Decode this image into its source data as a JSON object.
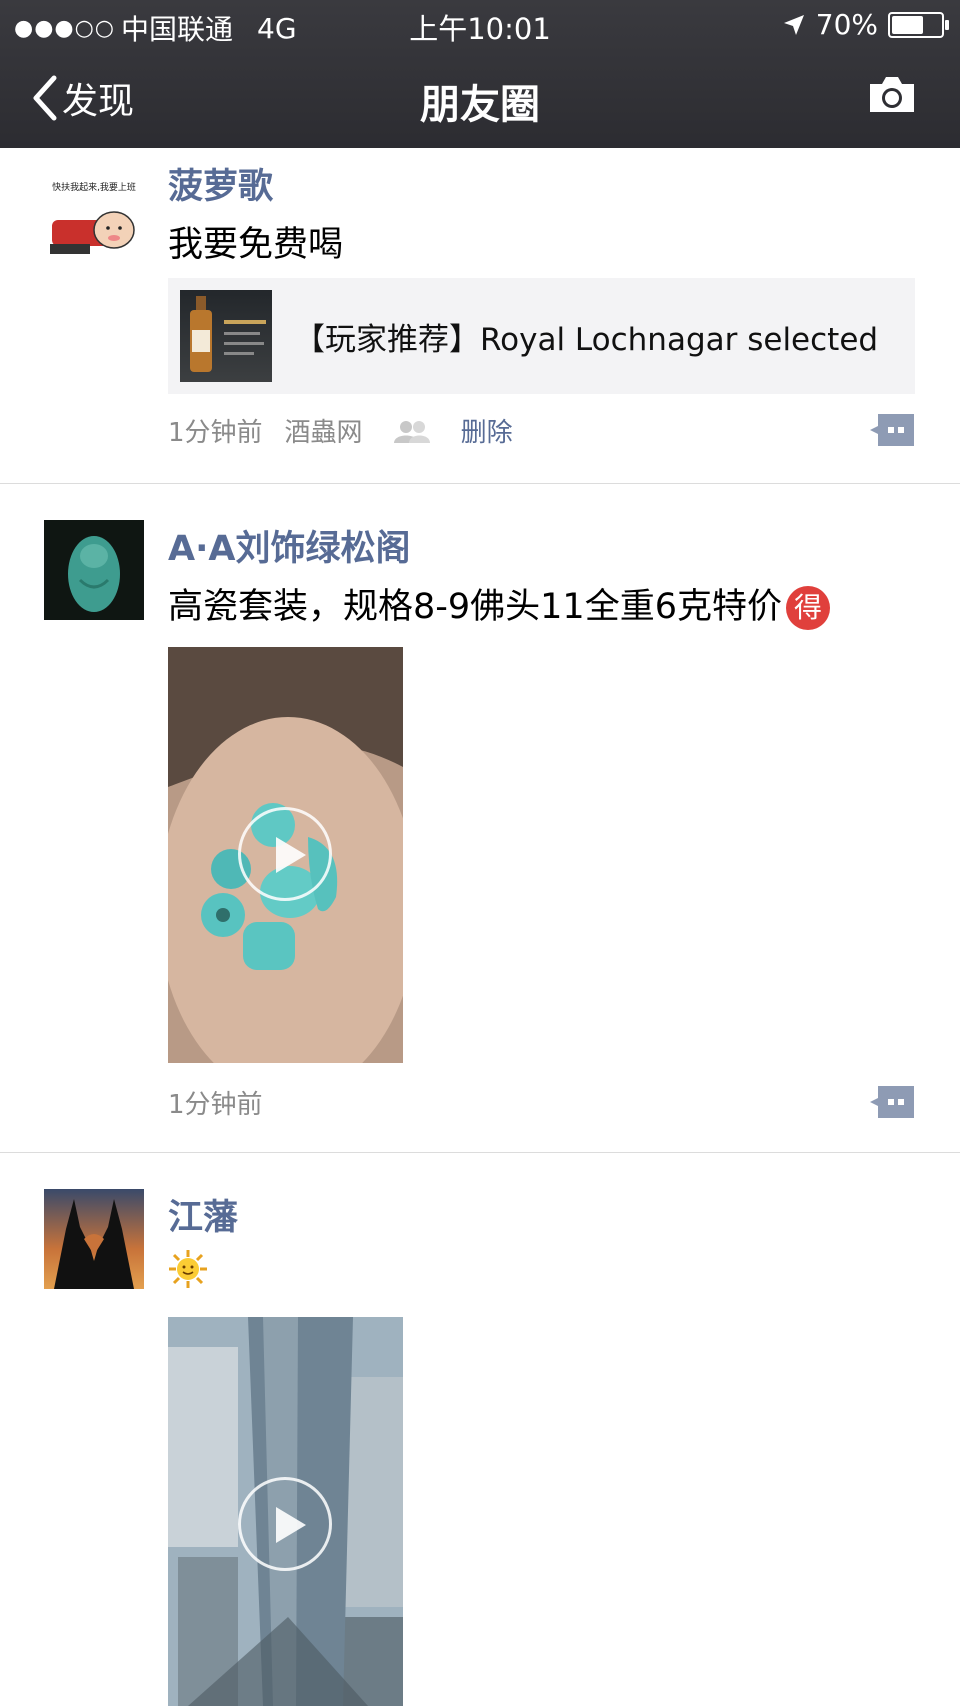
{
  "status_bar": {
    "signal_dots": "●●●○○",
    "carrier": "中国联通",
    "network": "4G",
    "time": "上午10:01",
    "battery_percent": "70%",
    "battery_level": 0.7
  },
  "nav": {
    "back_label": "发现",
    "title": "朋友圈",
    "camera_icon": "camera-icon"
  },
  "posts": [
    {
      "name": "菠萝歌",
      "text": "我要免费喝",
      "link_title": "【玩家推荐】Royal Lochnagar selected",
      "time": "1分钟前",
      "source": "酒蟲网",
      "delete_label": "删除"
    },
    {
      "name": "A·A刘饰绿松阁",
      "text": "高瓷套装，规格8-9佛头11全重6克特价",
      "badge": "得",
      "time": "1分钟前"
    },
    {
      "name": "江藩",
      "emoji": "🌞"
    }
  ],
  "colors": {
    "name": "#576b95",
    "nav_bg": "#2e2e33",
    "meta": "#8a8a8a"
  }
}
